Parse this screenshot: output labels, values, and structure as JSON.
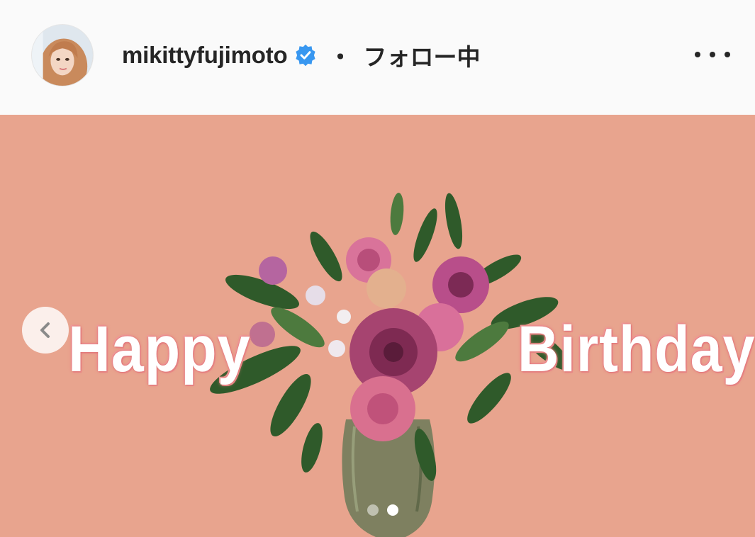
{
  "post_header": {
    "avatar_icon": "profile-photo",
    "username": "mikittyfujimoto",
    "verified_icon": "verified-badge-icon",
    "verified_color": "#3897f0",
    "separator": "・",
    "follow_status": "フォロー中",
    "more_icon": "more-options-icon"
  },
  "post_image": {
    "background_color": "#e8a48e",
    "overlay_text_left": "Happy",
    "overlay_text_right": "Birthday",
    "prev_icon": "chevron-left-icon",
    "carousel": {
      "total": 2,
      "current": 2
    }
  }
}
